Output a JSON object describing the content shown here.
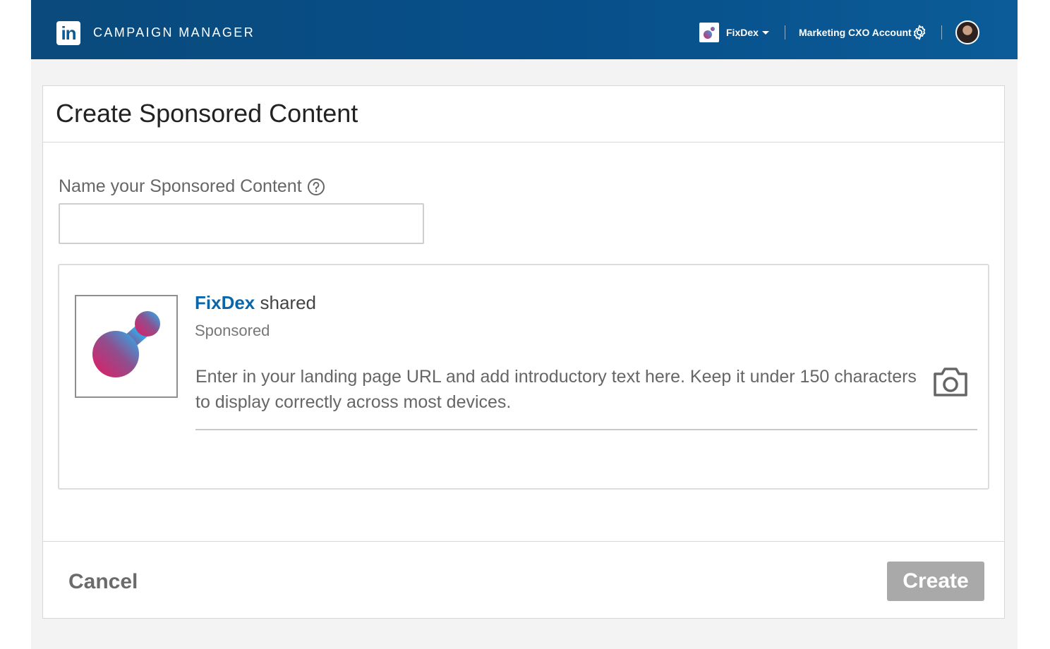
{
  "header": {
    "logo_text": "in",
    "product_name": "CAMPAIGN MANAGER",
    "account_name": "FixDex",
    "organization_name": "Marketing CXO Account"
  },
  "form": {
    "title": "Create Sponsored Content",
    "name_label": "Name your Sponsored Content",
    "name_value": "",
    "name_placeholder": ""
  },
  "preview": {
    "company_name": "FixDex",
    "shared_text": " shared",
    "sponsored_label": "Sponsored",
    "intro_placeholder": "Enter in your landing page URL and add introductory text here. Keep it under 150 characters to display correctly across most devices."
  },
  "footer": {
    "cancel_label": "Cancel",
    "create_label": "Create"
  },
  "colors": {
    "header_bg": "#074f8a",
    "link_blue": "#0a66a8",
    "create_disabled": "#a9a9a9",
    "logo_gradient_start": "#d5246b",
    "logo_gradient_end": "#3aa0e0"
  },
  "icons": [
    "linkedin-logo-icon",
    "dropdown-caret-icon",
    "gear-icon",
    "avatar",
    "help-icon",
    "camera-icon",
    "fixdex-logo"
  ]
}
